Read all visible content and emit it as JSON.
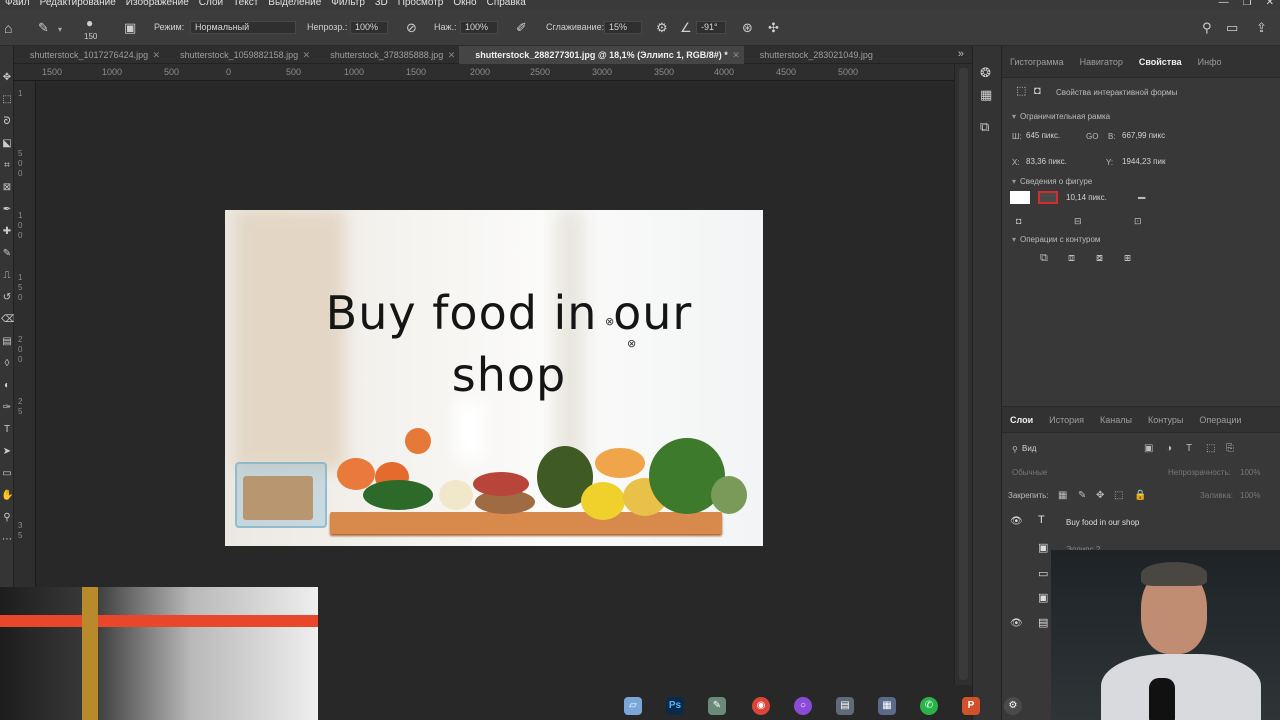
{
  "menubar": {
    "items": [
      "Файл",
      "Редактирование",
      "Изображение",
      "Слои",
      "Текст",
      "Выделение",
      "Фильтр",
      "3D",
      "Просмотр",
      "Окно",
      "Справка"
    ]
  },
  "options": {
    "brush_size": "150",
    "mode_label": "Режим:",
    "mode_value": "Нормальный",
    "opacity_label": "Непрозр.:",
    "opacity_value": "100%",
    "pressure_label": "Наж.:",
    "pressure_value": "100%",
    "smoothing_label": "Сглаживание:",
    "smoothing_value": "15%",
    "angle_value": "-91°"
  },
  "tabs": [
    {
      "label": "shutterstock_1017276424.jpg",
      "active": false
    },
    {
      "label": "shutterstock_1059882158.jpg",
      "active": false
    },
    {
      "label": "shutterstock_378385888.jpg",
      "active": false
    },
    {
      "label": "shutterstock_288277301.jpg @ 18,1% (Эллипс 1, RGB/8#) *",
      "active": true
    },
    {
      "label": "shutterstock_283021049.jpg",
      "active": false
    }
  ],
  "ruler": {
    "h_ticks": [
      "1500",
      "1000",
      "500",
      "0",
      "500",
      "1000",
      "1500",
      "2000",
      "2500",
      "3000",
      "3500",
      "4000",
      "4500",
      "5000"
    ],
    "v_ticks": [
      "1",
      "5",
      "0",
      "0",
      "1",
      "0",
      "0",
      "1",
      "5",
      "0",
      "2",
      "0",
      "0",
      "2",
      "5",
      "3",
      "5"
    ]
  },
  "canvas": {
    "headline_line1": "Buy food in our",
    "headline_line2": "shop"
  },
  "panel_top": {
    "tabs": [
      "Гистограмма",
      "Навигатор",
      "Свойства",
      "Инфо"
    ],
    "active_tab": "Свойства",
    "props_title": "Свойства интерактивной формы",
    "bounding_box": "Ограничительная рамка",
    "w_label": "Ш:",
    "w_value": "645 пикс.",
    "link_label": "GO",
    "h_label": "В:",
    "h_value": "667,99 пикс",
    "x_label": "X:",
    "x_value": "83,36 пикс.",
    "y_label": "Y:",
    "y_value": "1944,23 пик",
    "shape_info": "Сведения о фигуре",
    "stroke_width": "10,14 пикс.",
    "path_ops": "Операции с контуром"
  },
  "panel_bottom": {
    "tabs": [
      "Слои",
      "История",
      "Каналы",
      "Контуры",
      "Операции"
    ],
    "active_tab": "Слои",
    "filter_label": "Вид",
    "blend_mode": "Обычные",
    "opacity_label": "Непрозрачность:",
    "opacity_value": "100%",
    "lock_label": "Закрепить:",
    "fill_label": "Заливка:",
    "fill_value": "100%",
    "layers": [
      {
        "name": "Buy food in our shop",
        "type": "text",
        "visible": true
      },
      {
        "name": "Эллипс 2",
        "type": "shape",
        "visible": false
      },
      {
        "name": "",
        "type": "shape",
        "visible": false
      },
      {
        "name": "",
        "type": "shape",
        "visible": false
      },
      {
        "name": "",
        "type": "image",
        "visible": true
      }
    ]
  },
  "taskbar": {
    "apps": [
      "files",
      "Ps",
      "brush-app",
      "chrome",
      "circle-app",
      "folder",
      "store",
      "whatsapp",
      "Ps-orange",
      "gear-app"
    ]
  }
}
